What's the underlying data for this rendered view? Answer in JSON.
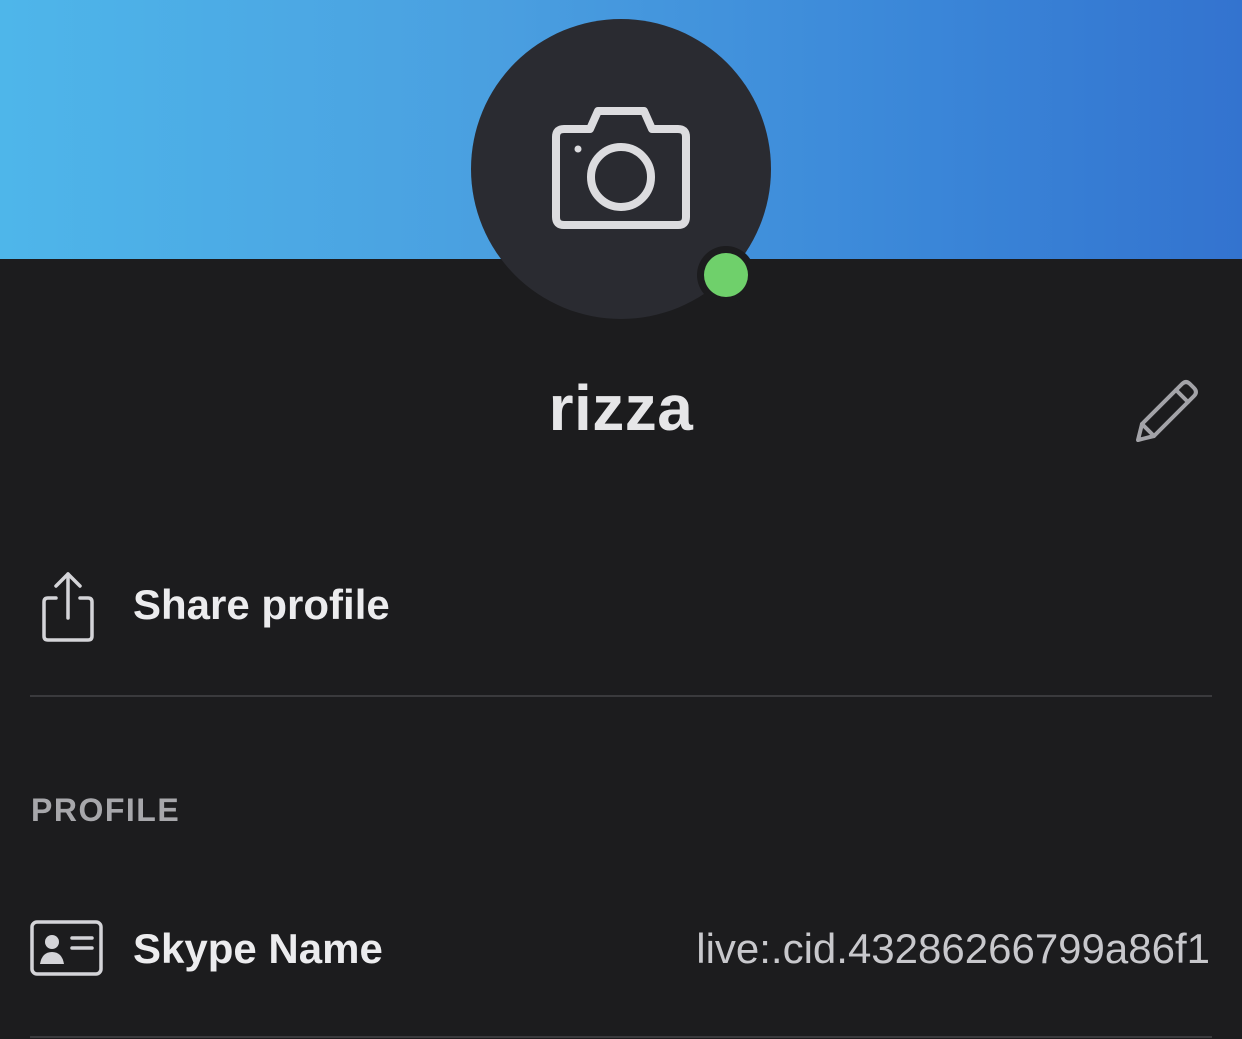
{
  "profile": {
    "display_name": "rizza",
    "presence_status": "online",
    "presence_color": "#6fd06b",
    "banner_colors": [
      "#4eb6ea",
      "#3373cf"
    ]
  },
  "actions": {
    "share_label": "Share profile",
    "edit_icon": "pencil-icon",
    "share_icon": "share-icon"
  },
  "sections": {
    "profile_header": "PROFILE"
  },
  "fields": [
    {
      "label": "Skype Name",
      "value": "live:.cid.43286266799a86f1",
      "icon": "id-card-icon"
    }
  ]
}
